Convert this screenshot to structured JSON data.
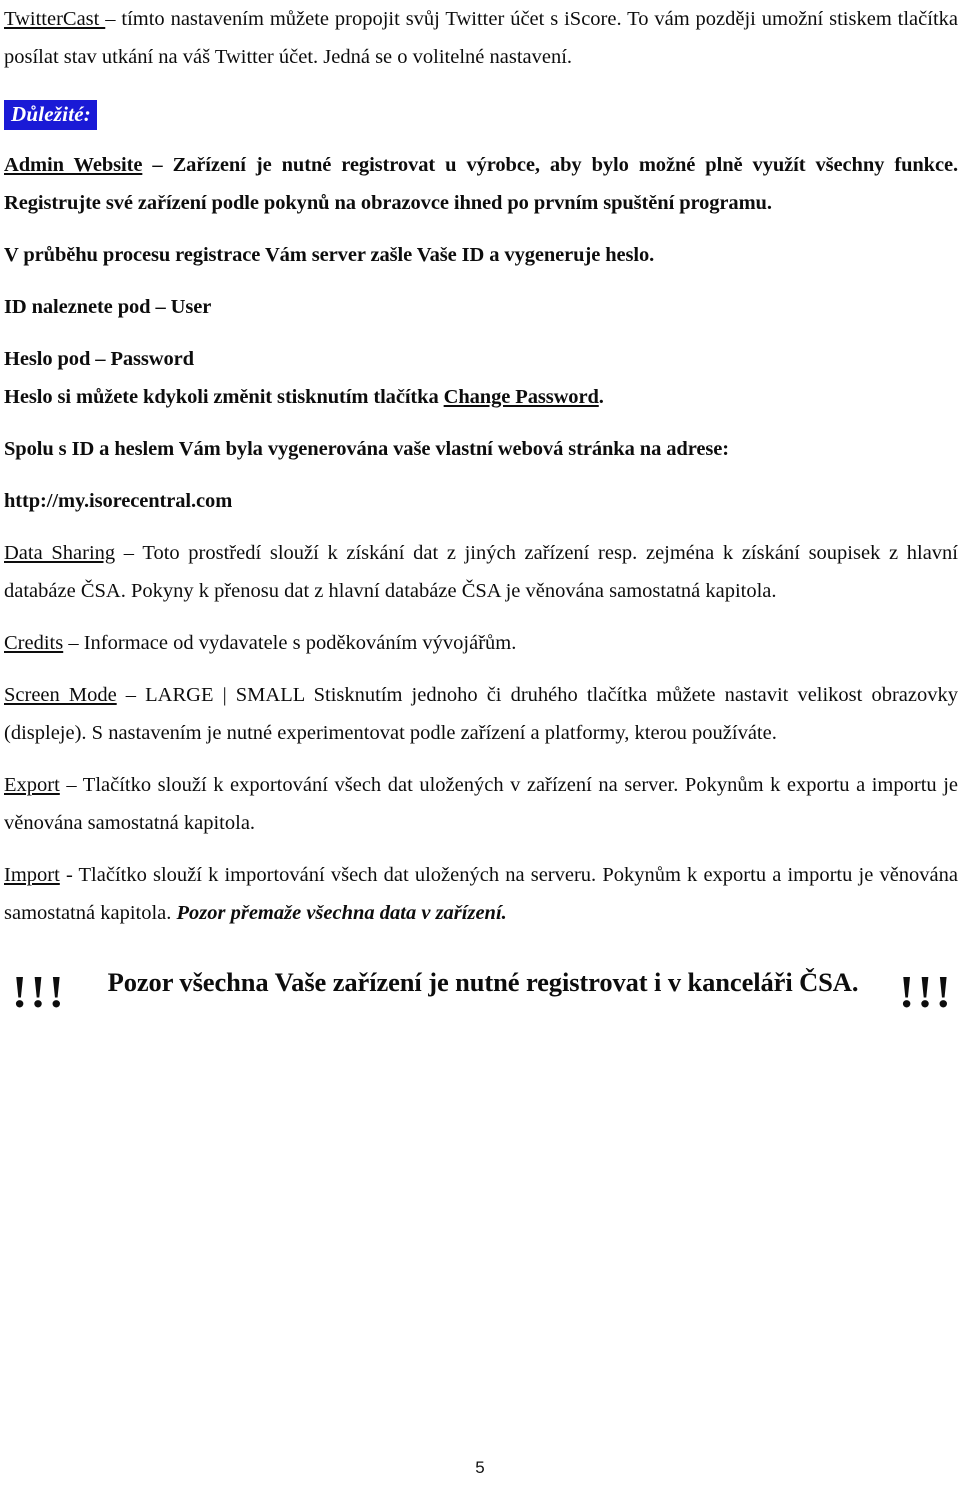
{
  "document": {
    "language": "cs",
    "page_number": "5",
    "highlight_color": "#1a1ad6",
    "text_color": "#0d0d0d",
    "background_color": "#ffffff"
  },
  "paragraphs": {
    "twittercast": {
      "term": "TwitterCast ",
      "body": "– tímto nastavením můžete propojit svůj Twitter účet s iScore. To vám později umožní stiskem tlačítka posílat stav utkání na váš Twitter účet. Jedná se o volitelné nastavení."
    },
    "important_label": "Důležité:",
    "admin_website": {
      "term": "Admin Website",
      "body": " – Zařízení je nutné registrovat u výrobce, aby bylo možné plně využít všechny funkce. Registrujte své zařízení podle pokynů na obrazovce ihned po prvním spuštění programu."
    },
    "registration_process": "V průběhu procesu registrace Vám server zašle Vaše ID a vygeneruje heslo.",
    "id_line": "ID naleznete pod – User",
    "password_line": "Heslo pod – Password",
    "change_password": {
      "prefix": "Heslo si můžete kdykoli změnit stisknutím tlačítka ",
      "link": "Change Password",
      "suffix": "."
    },
    "own_page": "Spolu s ID a heslem Vám byla vygenerována vaše vlastní webová stránka na adrese:",
    "url": "http://my.isorecentral.com",
    "data_sharing": {
      "term": "Data Sharing",
      "body": " – Toto prostředí slouží k získání dat z jiných zařízení resp. zejména k získání soupisek z hlavní databáze ČSA. Pokyny k přenosu dat z hlavní databáze ČSA je věnována samostatná kapitola."
    },
    "credits": {
      "term": "Credits",
      "body": " – Informace od vydavatele s poděkováním vývojářům."
    },
    "screen_mode": {
      "term": "Screen Mode",
      "body": " – LARGE | SMALL Stisknutím jednoho či druhého tlačítka můžete nastavit velikost obrazovky (displeje). S nastavením je nutné experimentovat podle zařízení a platformy, kterou používáte."
    },
    "export": {
      "term": "Export",
      "body": " – Tlačítko slouží k exportování všech dat uložených v zařízení na server. Pokynům k exportu a importu je věnována samostatná kapitola."
    },
    "import": {
      "term": "Import",
      "body": " - Tlačítko slouží k importování všech dat uložených na serveru. Pokynům k exportu a importu je věnována samostatná kapitola. ",
      "emphasis": "Pozor přemaže všechna data v zařízení."
    },
    "final_warning": {
      "bangs_left": "!!!",
      "text": "Pozor všechna Vaše zařízení je nutné registrovat i v kanceláři ČSA.",
      "bangs_right": "!!!"
    }
  }
}
